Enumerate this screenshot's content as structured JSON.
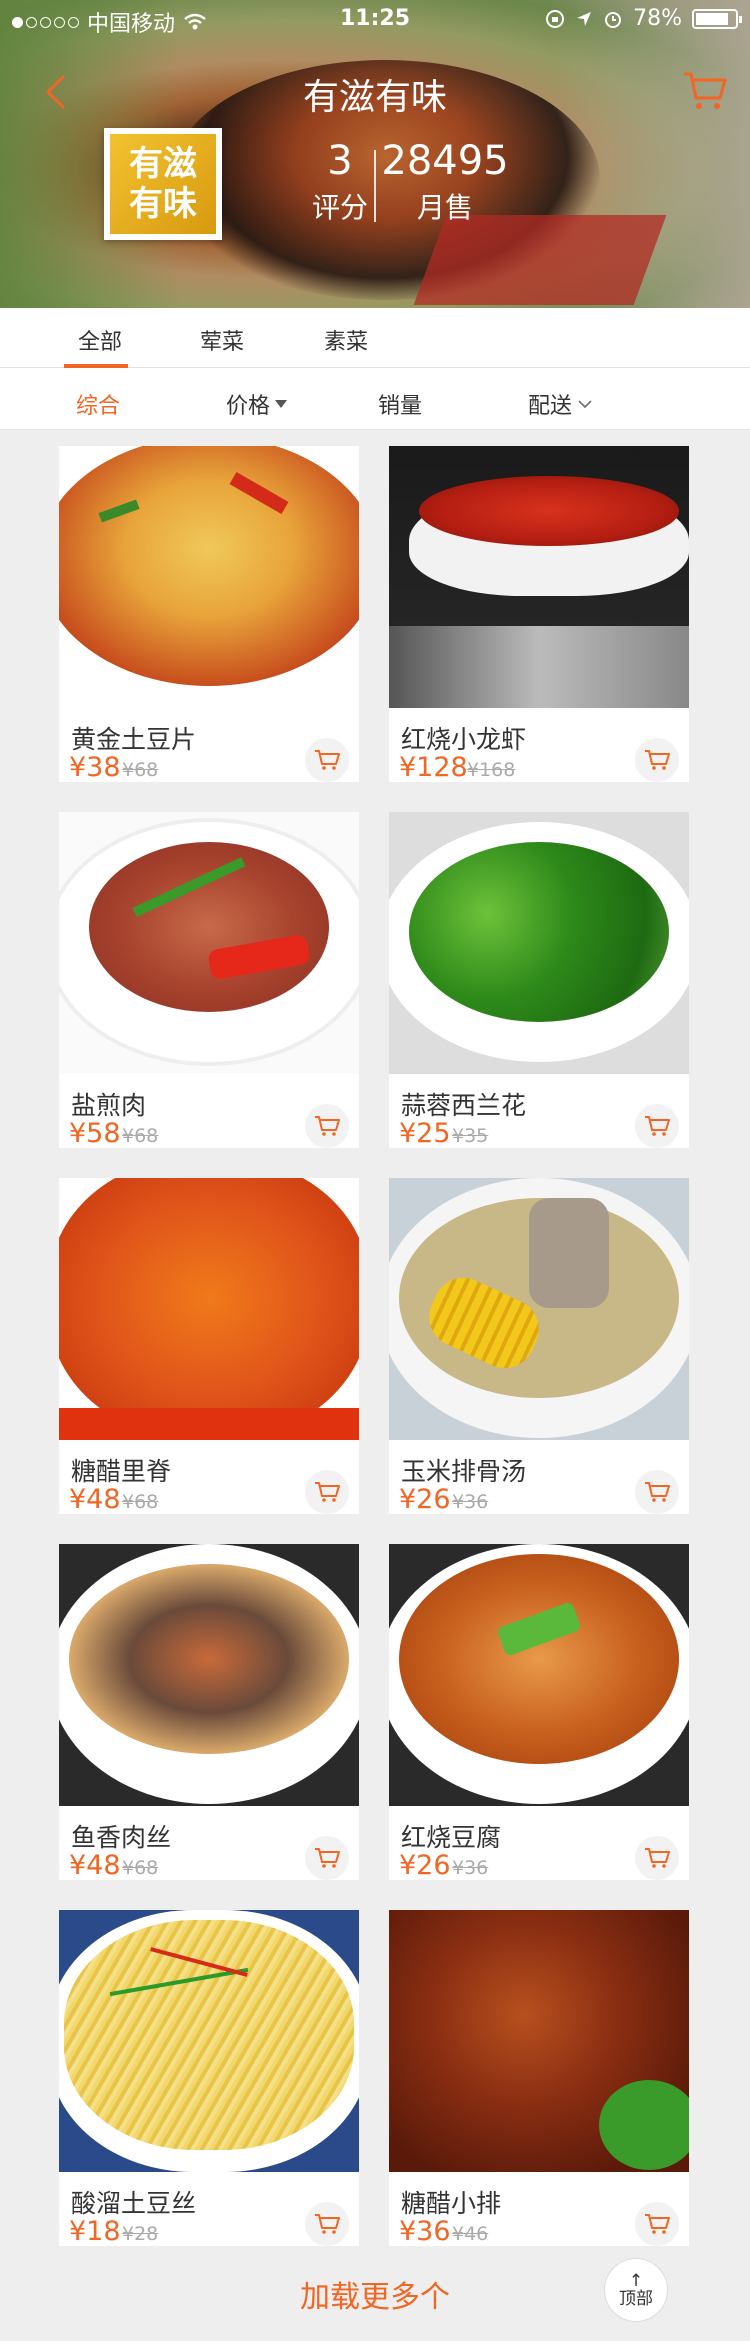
{
  "status_bar": {
    "carrier": "中国移动",
    "time": "11:25",
    "battery": "78%"
  },
  "shop": {
    "title": "有滋有味",
    "logo_line1": "有滋",
    "logo_line2": "有味",
    "rating": "3",
    "rating_label": "评分",
    "monthly_sales": "28495",
    "monthly_sales_label": "月售"
  },
  "tabs": [
    "全部",
    "荤菜",
    "素菜"
  ],
  "filters": [
    "综合",
    "价格",
    "销量",
    "配送"
  ],
  "products": [
    {
      "name": "黄金土豆片",
      "price": "¥38",
      "old_price": "¥68",
      "photo": "potato-slices"
    },
    {
      "name": "红烧小龙虾",
      "price": "¥128",
      "old_price": "¥168",
      "photo": "crayfish"
    },
    {
      "name": "盐煎肉",
      "price": "¥58",
      "old_price": "¥68",
      "photo": "fried-pork"
    },
    {
      "name": "蒜蓉西兰花",
      "price": "¥25",
      "old_price": "¥35",
      "photo": "broccoli"
    },
    {
      "name": "糖醋里脊",
      "price": "¥48",
      "old_price": "¥68",
      "photo": "sweet-sour-pork"
    },
    {
      "name": "玉米排骨汤",
      "price": "¥26",
      "old_price": "¥36",
      "photo": "corn-rib-soup"
    },
    {
      "name": "鱼香肉丝",
      "price": "¥48",
      "old_price": "¥68",
      "photo": "yuxiang-pork"
    },
    {
      "name": "红烧豆腐",
      "price": "¥26",
      "old_price": "¥36",
      "photo": "braised-tofu"
    },
    {
      "name": "酸溜土豆丝",
      "price": "¥18",
      "old_price": "¥28",
      "photo": "potato-shreds"
    },
    {
      "name": "糖醋小排",
      "price": "¥36",
      "old_price": "¥46",
      "photo": "sweet-sour-ribs"
    }
  ],
  "footer": {
    "load_more": "加载更多个",
    "top_line1": "↑",
    "top_line2": "顶部"
  },
  "colors": {
    "accent": "#f26522"
  }
}
